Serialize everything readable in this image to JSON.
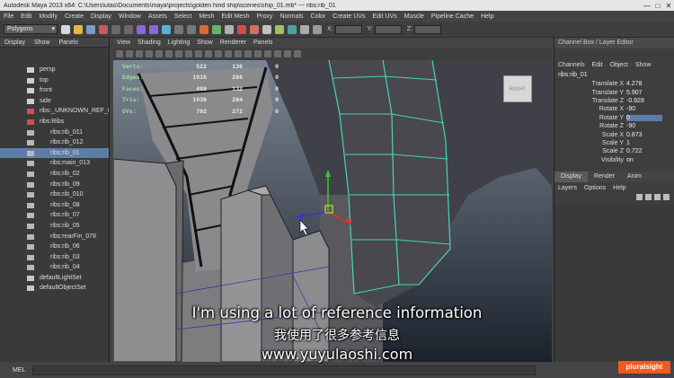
{
  "titlebar": {
    "title": "Autodesk Maya 2013 x64: C:\\Users\\utas\\Documents\\maya\\projects\\golden hind ship\\scenes\\ship_01.mb* --- ribs:rib_01",
    "minimize": "—",
    "maximize": "□",
    "close": "✕"
  },
  "menubar": [
    "File",
    "Edit",
    "Modify",
    "Create",
    "Display",
    "Window",
    "Assets",
    "Select",
    "Mesh",
    "Edit Mesh",
    "Proxy",
    "Normals",
    "Color",
    "Create UVs",
    "Edit UVs",
    "Muscle",
    "Pipeline Cache",
    "Help"
  ],
  "shelf": {
    "mode": "Polygons",
    "x_label": "X:",
    "y_label": "Y:",
    "z_label": "Z:"
  },
  "outliner": {
    "menu": [
      "Display",
      "Show",
      "Panels"
    ],
    "items": [
      {
        "label": "persp",
        "indent": 0,
        "selected": false,
        "type": "camera"
      },
      {
        "label": "top",
        "indent": 0,
        "selected": false,
        "type": "camera"
      },
      {
        "label": "front",
        "indent": 0,
        "selected": false,
        "type": "camera"
      },
      {
        "label": "side",
        "indent": 0,
        "selected": false,
        "type": "camera"
      },
      {
        "label": "ribs:_UNKNOWN_REF_N",
        "indent": 0,
        "selected": false,
        "type": "ref"
      },
      {
        "label": "ribs:Ribs",
        "indent": 0,
        "selected": false,
        "type": "ref"
      },
      {
        "label": "ribs:rib_011",
        "indent": 1,
        "selected": false,
        "type": "mesh"
      },
      {
        "label": "ribs:rib_012",
        "indent": 1,
        "selected": false,
        "type": "mesh"
      },
      {
        "label": "ribs:rib_01",
        "indent": 1,
        "selected": true,
        "type": "mesh"
      },
      {
        "label": "ribs:main_013",
        "indent": 1,
        "selected": false,
        "type": "mesh"
      },
      {
        "label": "ribs:rib_02",
        "indent": 1,
        "selected": false,
        "type": "mesh"
      },
      {
        "label": "ribs:rib_09",
        "indent": 1,
        "selected": false,
        "type": "mesh"
      },
      {
        "label": "ribs:rib_010",
        "indent": 1,
        "selected": false,
        "type": "mesh"
      },
      {
        "label": "ribs:rib_08",
        "indent": 1,
        "selected": false,
        "type": "mesh"
      },
      {
        "label": "ribs:rib_07",
        "indent": 1,
        "selected": false,
        "type": "mesh"
      },
      {
        "label": "ribs:rib_05",
        "indent": 1,
        "selected": false,
        "type": "mesh"
      },
      {
        "label": "ribs:rearFin_078",
        "indent": 1,
        "selected": false,
        "type": "mesh"
      },
      {
        "label": "ribs:rib_06",
        "indent": 1,
        "selected": false,
        "type": "mesh"
      },
      {
        "label": "ribs:rib_03",
        "indent": 1,
        "selected": false,
        "type": "mesh"
      },
      {
        "label": "ribs:rib_04",
        "indent": 1,
        "selected": false,
        "type": "mesh"
      },
      {
        "label": "defaultLightSet",
        "indent": 0,
        "selected": false,
        "type": "set"
      },
      {
        "label": "defaultObjectSet",
        "indent": 0,
        "selected": false,
        "type": "set"
      }
    ]
  },
  "viewport": {
    "menu": [
      "View",
      "Shading",
      "Lighting",
      "Show",
      "Renderer",
      "Panels"
    ],
    "hud": [
      {
        "label": "Verts:",
        "a": "522",
        "b": "136",
        "c": "0"
      },
      {
        "label": "Edges:",
        "a": "1016",
        "b": "266",
        "c": "0"
      },
      {
        "label": "Faces:",
        "a": "498",
        "b": "132",
        "c": "0"
      },
      {
        "label": "Tris:",
        "a": "1036",
        "b": "264",
        "c": "0"
      },
      {
        "label": "UVs:",
        "a": "792",
        "b": "272",
        "c": "0"
      }
    ],
    "viewcube_label": "RIGHT"
  },
  "channel_box": {
    "title": "Channel Box / Layer Editor",
    "menu": [
      "Channels",
      "Edit",
      "Object",
      "Show"
    ],
    "object": "ribs:rib_01",
    "attrs": [
      {
        "name": "Translate X",
        "value": "4.278",
        "highlight": false
      },
      {
        "name": "Translate Y",
        "value": "5.907",
        "highlight": false
      },
      {
        "name": "Translate Z",
        "value": "-0.928",
        "highlight": false
      },
      {
        "name": "Rotate X",
        "value": "-90",
        "highlight": false
      },
      {
        "name": "Rotate Y",
        "value": "0",
        "highlight": true
      },
      {
        "name": "Rotate Z",
        "value": "-90",
        "highlight": false
      },
      {
        "name": "Scale X",
        "value": "0.873",
        "highlight": false
      },
      {
        "name": "Scale Y",
        "value": "1",
        "highlight": false
      },
      {
        "name": "Scale Z",
        "value": "0.722",
        "highlight": false
      },
      {
        "name": "Visibility",
        "value": "on",
        "highlight": false
      }
    ],
    "tabs": [
      "Display",
      "Render",
      "Anim"
    ],
    "active_tab": "Display",
    "layer_menu": [
      "Layers",
      "Options",
      "Help"
    ]
  },
  "command_line": {
    "label": "MEL"
  },
  "subtitles": {
    "english": "I'm using a lot of reference information",
    "chinese": "我使用了很多参考信息",
    "site": "www.yuyulaoshi.com"
  },
  "brand": "pluralsight",
  "colors": {
    "selection": "#5e7da6",
    "hud_label": "#9fe09a",
    "wire": "#45d6b6",
    "brand": "#f15a24"
  }
}
